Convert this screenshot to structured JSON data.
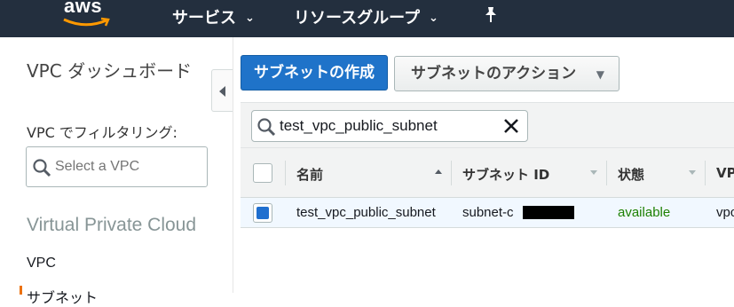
{
  "topnav": {
    "logo": "aws",
    "services": "サービス",
    "resource_groups": "リソースグループ",
    "chevron": "⌄"
  },
  "sidebar": {
    "title": "VPC ダッシュボード",
    "filter_label": "VPC でフィルタリング:",
    "vpc_select_placeholder": "Select a VPC",
    "section": "Virtual Private Cloud",
    "links": [
      "VPC",
      "サブネット"
    ]
  },
  "main": {
    "create_button": "サブネットの作成",
    "actions_button": "サブネットのアクション",
    "search_value": "test_vpc_public_subnet",
    "table": {
      "headers": [
        "名前",
        "サブネット ID",
        "状態",
        "VP"
      ],
      "rows": [
        {
          "name": "test_vpc_public_subnet",
          "subnet_id": "subnet-c",
          "state": "available",
          "vpc": "vpc"
        }
      ]
    }
  },
  "colors": {
    "nav_bg": "#232f3e",
    "primary": "#1f73c9",
    "available": "#1d8102",
    "accent": "#ff9900"
  }
}
